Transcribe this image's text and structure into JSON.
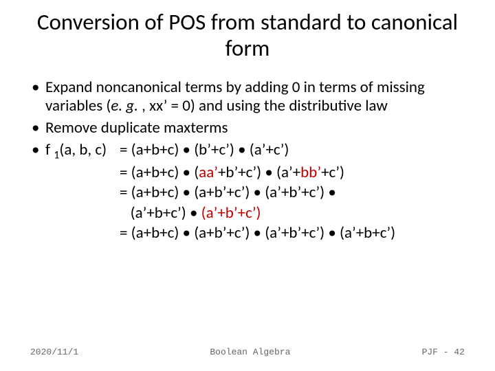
{
  "title": "Conversion of POS from standard to canonical form",
  "bullet1_a": "Expand noncanonical terms by adding 0 in terms of missing variables (",
  "bullet1_b": "e. g.",
  "bullet1_c": " , xx’ = 0) and using the distributive law",
  "bullet2": "Remove duplicate maxterms",
  "eq_label_a": "f ",
  "eq_label_b": "1",
  "eq_label_c": "(a, b, c)",
  "line1": "= (a+b+c) • (b’+c’) • (a’+c’)",
  "line2_a": "= (a+b+c) • (",
  "line2_b": "aa’",
  "line2_c": "+b’+c’) • (a’+",
  "line2_d": "bb’",
  "line2_e": "+c’)",
  "line3": "= (a+b+c) • (a+b’+c’) • (a’+b’+c’) •",
  "line3b_a": "   (a’+b+c’) • ",
  "line3b_b": "(a’+b’+c’)",
  "line4": "= (a+b+c) • (a+b’+c’) • (a’+b’+c’) • (a’+b+c’)",
  "footer_date": "2020/11/1",
  "footer_center": "Boolean Algebra",
  "footer_right": "PJF - 42"
}
